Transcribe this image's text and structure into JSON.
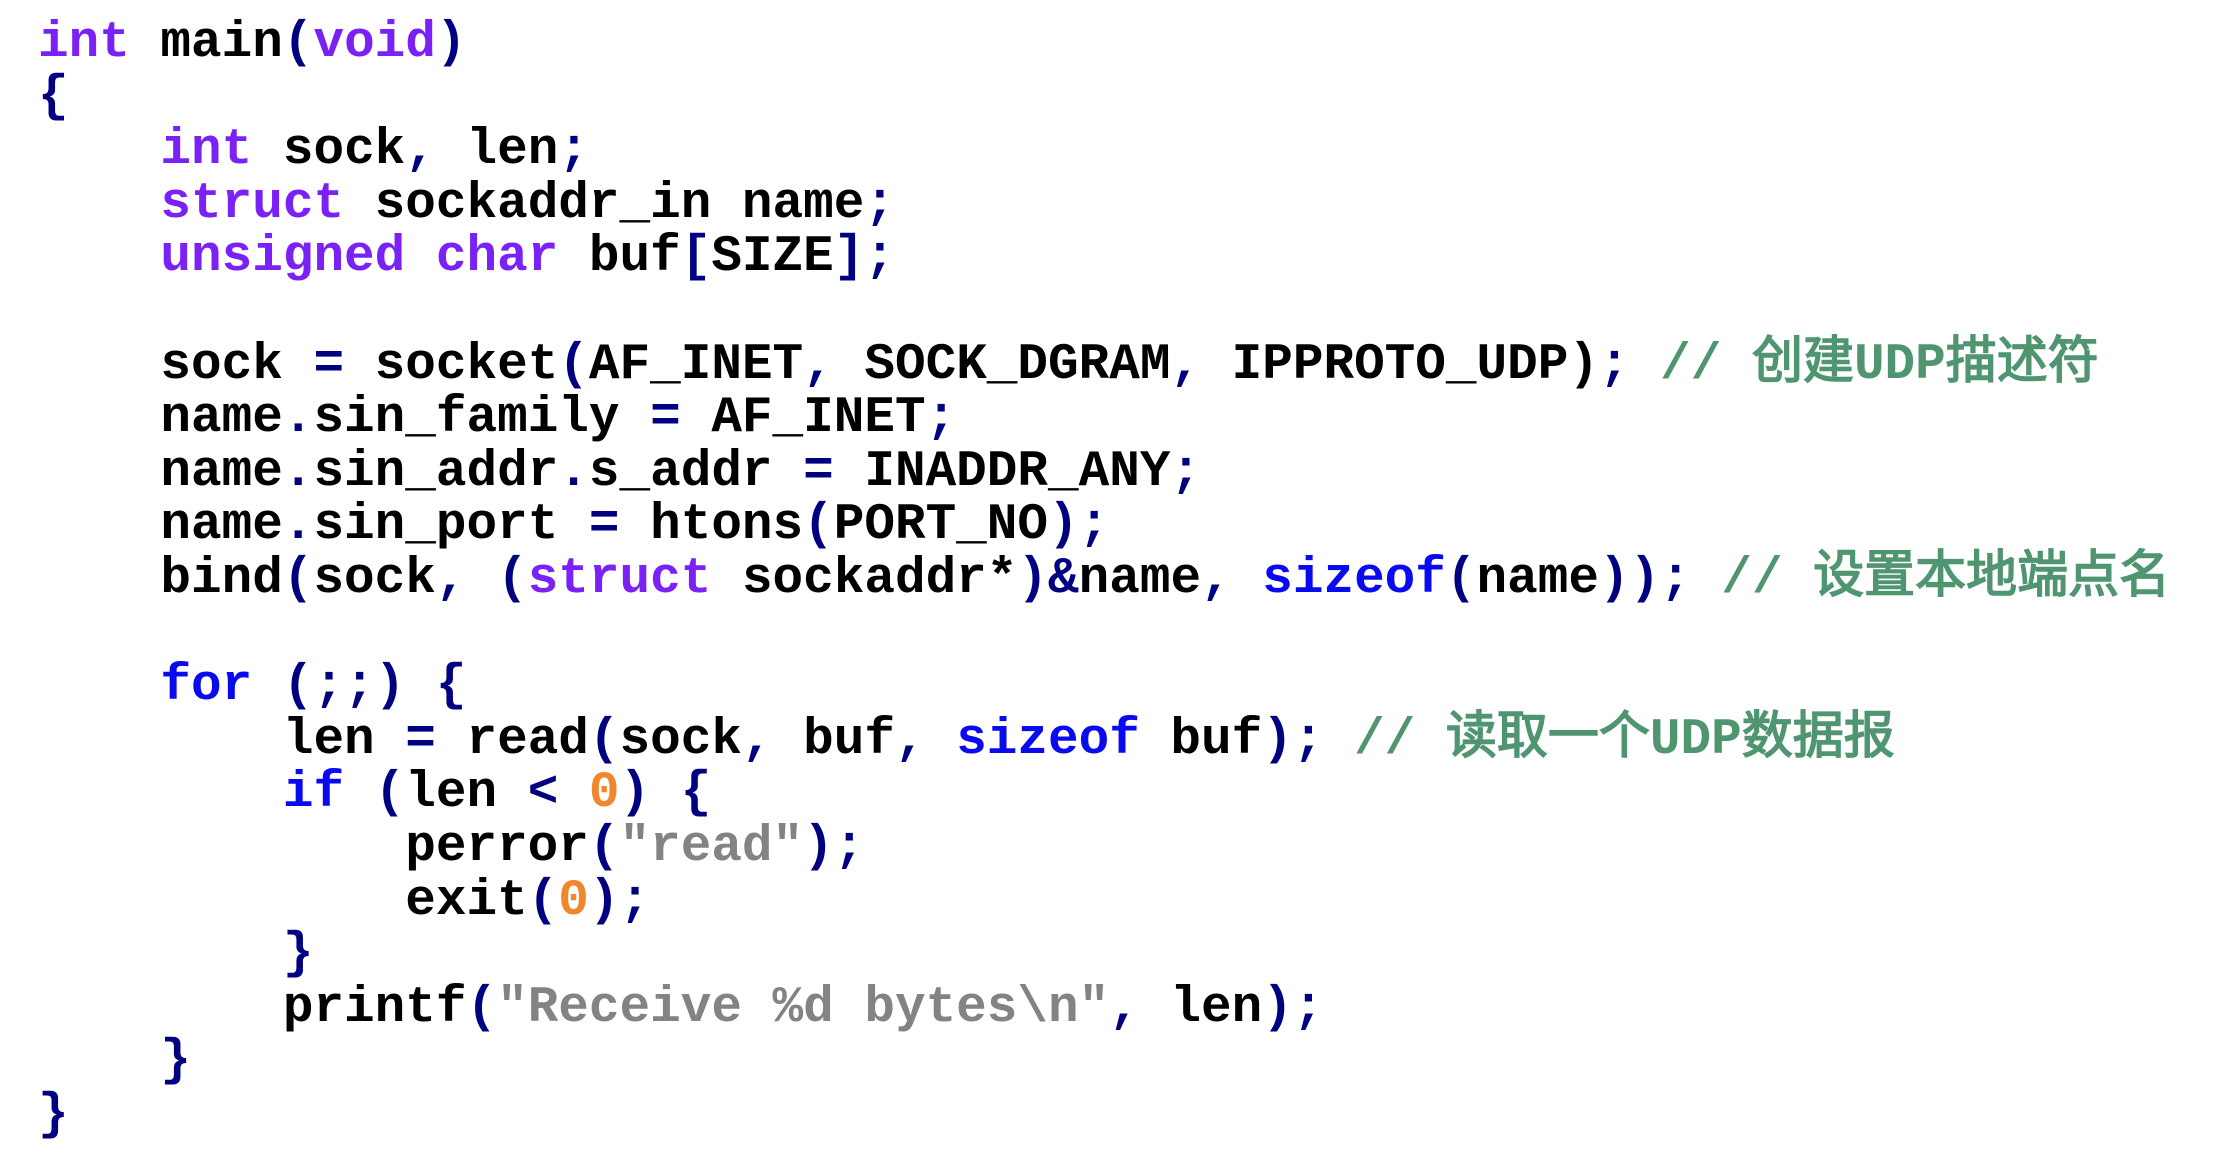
{
  "colors": {
    "keyword": "#7a22f5",
    "control": "#0a0af0",
    "punctuation": "#000080",
    "number": "#f0872c",
    "string": "#838383",
    "comment": "#4f9570",
    "identifier": "#000000"
  },
  "code": {
    "lines": [
      [
        [
          "int",
          "kw"
        ],
        [
          " main",
          "id"
        ],
        [
          "(",
          "p"
        ],
        [
          "void",
          "kw"
        ],
        [
          ")",
          "p"
        ]
      ],
      [
        [
          "{",
          "p"
        ]
      ],
      [
        [
          "    ",
          "id"
        ],
        [
          "int",
          "kw"
        ],
        [
          " sock",
          "id"
        ],
        [
          ",",
          "p"
        ],
        [
          " len",
          "id"
        ],
        [
          ";",
          "p"
        ]
      ],
      [
        [
          "    ",
          "id"
        ],
        [
          "struct",
          "kw"
        ],
        [
          " sockaddr_in name",
          "id"
        ],
        [
          ";",
          "p"
        ]
      ],
      [
        [
          "    ",
          "id"
        ],
        [
          "unsigned",
          "kw"
        ],
        [
          " ",
          "id"
        ],
        [
          "char",
          "kw"
        ],
        [
          " buf",
          "id"
        ],
        [
          "[",
          "p"
        ],
        [
          "SIZE",
          "id"
        ],
        [
          "]",
          "p"
        ],
        [
          ";",
          "p"
        ]
      ],
      [],
      [
        [
          "    sock ",
          "id"
        ],
        [
          "=",
          "p"
        ],
        [
          " socket",
          "id"
        ],
        [
          "(",
          "p"
        ],
        [
          "AF_INET",
          "id"
        ],
        [
          ",",
          "p"
        ],
        [
          " SOCK_DGRAM",
          "id"
        ],
        [
          ",",
          "p"
        ],
        [
          " IPPROTO_UDP",
          "id"
        ],
        [
          ")",
          "id"
        ],
        [
          ";",
          "p"
        ],
        [
          " // 创建UDP描述符",
          "cm"
        ]
      ],
      [
        [
          "    name",
          "id"
        ],
        [
          ".",
          "p"
        ],
        [
          "sin_family ",
          "id"
        ],
        [
          "=",
          "p"
        ],
        [
          " AF_INET",
          "id"
        ],
        [
          ";",
          "p"
        ]
      ],
      [
        [
          "    name",
          "id"
        ],
        [
          ".",
          "p"
        ],
        [
          "sin_addr",
          "id"
        ],
        [
          ".",
          "p"
        ],
        [
          "s_addr ",
          "id"
        ],
        [
          "=",
          "p"
        ],
        [
          " INADDR_ANY",
          "id"
        ],
        [
          ";",
          "p"
        ]
      ],
      [
        [
          "    name",
          "id"
        ],
        [
          ".",
          "p"
        ],
        [
          "sin_port ",
          "id"
        ],
        [
          "=",
          "p"
        ],
        [
          " htons",
          "id"
        ],
        [
          "(",
          "p"
        ],
        [
          "PORT_NO",
          "id"
        ],
        [
          ")",
          "p"
        ],
        [
          ";",
          "p"
        ]
      ],
      [
        [
          "    bind",
          "id"
        ],
        [
          "(",
          "p"
        ],
        [
          "sock",
          "id"
        ],
        [
          ",",
          "p"
        ],
        [
          " ",
          "id"
        ],
        [
          "(",
          "p"
        ],
        [
          "struct",
          "kw"
        ],
        [
          " sockaddr*",
          "id"
        ],
        [
          ")",
          "p"
        ],
        [
          "&",
          "p"
        ],
        [
          "name",
          "id"
        ],
        [
          ",",
          "p"
        ],
        [
          " ",
          "id"
        ],
        [
          "sizeof",
          "ctl"
        ],
        [
          "(",
          "p"
        ],
        [
          "name",
          "id"
        ],
        [
          "))",
          "p"
        ],
        [
          ";",
          "p"
        ],
        [
          " // 设置本地端点名",
          "cm"
        ]
      ],
      [],
      [
        [
          "    ",
          "id"
        ],
        [
          "for",
          "ctl"
        ],
        [
          " ",
          "id"
        ],
        [
          "(;;)",
          "p"
        ],
        [
          " ",
          "id"
        ],
        [
          "{",
          "p"
        ]
      ],
      [
        [
          "        len ",
          "id"
        ],
        [
          "=",
          "p"
        ],
        [
          " read",
          "id"
        ],
        [
          "(",
          "p"
        ],
        [
          "sock",
          "id"
        ],
        [
          ",",
          "p"
        ],
        [
          " buf",
          "id"
        ],
        [
          ",",
          "p"
        ],
        [
          " ",
          "id"
        ],
        [
          "sizeof",
          "ctl"
        ],
        [
          " buf",
          "id"
        ],
        [
          ")",
          "p"
        ],
        [
          ";",
          "p"
        ],
        [
          " // 读取一个UDP数据报",
          "cm"
        ]
      ],
      [
        [
          "        ",
          "id"
        ],
        [
          "if",
          "ctl"
        ],
        [
          " ",
          "id"
        ],
        [
          "(",
          "p"
        ],
        [
          "len ",
          "id"
        ],
        [
          "<",
          "p"
        ],
        [
          " ",
          "id"
        ],
        [
          "0",
          "num"
        ],
        [
          ")",
          "p"
        ],
        [
          " ",
          "id"
        ],
        [
          "{",
          "p"
        ]
      ],
      [
        [
          "            perror",
          "id"
        ],
        [
          "(",
          "p"
        ],
        [
          "\"read\"",
          "str"
        ],
        [
          ")",
          "p"
        ],
        [
          ";",
          "p"
        ]
      ],
      [
        [
          "            exit",
          "id"
        ],
        [
          "(",
          "p"
        ],
        [
          "0",
          "num"
        ],
        [
          ")",
          "p"
        ],
        [
          ";",
          "p"
        ]
      ],
      [
        [
          "        ",
          "id"
        ],
        [
          "}",
          "p"
        ]
      ],
      [
        [
          "        printf",
          "id"
        ],
        [
          "(",
          "p"
        ],
        [
          "\"Receive %d bytes\\n\"",
          "str"
        ],
        [
          ",",
          "p"
        ],
        [
          " len",
          "id"
        ],
        [
          ")",
          "p"
        ],
        [
          ";",
          "p"
        ]
      ],
      [
        [
          "    ",
          "id"
        ],
        [
          "}",
          "p"
        ]
      ],
      [
        [
          "}",
          "p"
        ]
      ]
    ]
  }
}
